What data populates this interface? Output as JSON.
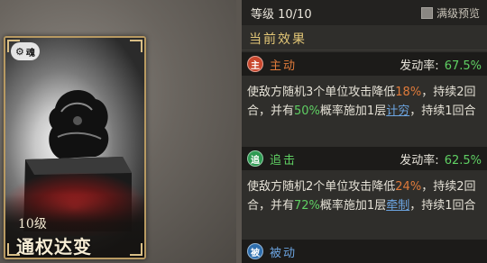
{
  "card": {
    "badge_text": "魂",
    "level": "10级",
    "name": "通权达变"
  },
  "header": {
    "level": "等级 10/10",
    "preview_label": "满级预览",
    "preview_checked": false
  },
  "section_title": "当前效果",
  "skills": [
    {
      "icon_char": "主",
      "type": "主动",
      "icon_color": "#c9472d",
      "type_color": "#e07b3b",
      "rate_label": "发动率:",
      "rate": "67.5%",
      "desc": {
        "p1": "使敌方随机3个单位攻击降低",
        "v1": "18%",
        "p2": "，持续2回合，并有",
        "v2": "50%",
        "p3": "概率施加1层",
        "link": "计穷",
        "p4": "，持续1回合"
      }
    },
    {
      "icon_char": "追",
      "type": "追击",
      "icon_color": "#2e9a52",
      "type_color": "#5fcf63",
      "rate_label": "发动率:",
      "rate": "62.5%",
      "desc": {
        "p1": "使敌方随机2个单位攻击降低",
        "v1": "24%",
        "p2": "，持续2回合，并有",
        "v2": "72%",
        "p3": "概率施加1层",
        "link": "牵制",
        "p4": "，持续1回合"
      }
    },
    {
      "icon_char": "被",
      "type": "被动",
      "icon_color": "#2f6fae",
      "type_color": "#6ca4e0"
    }
  ]
}
